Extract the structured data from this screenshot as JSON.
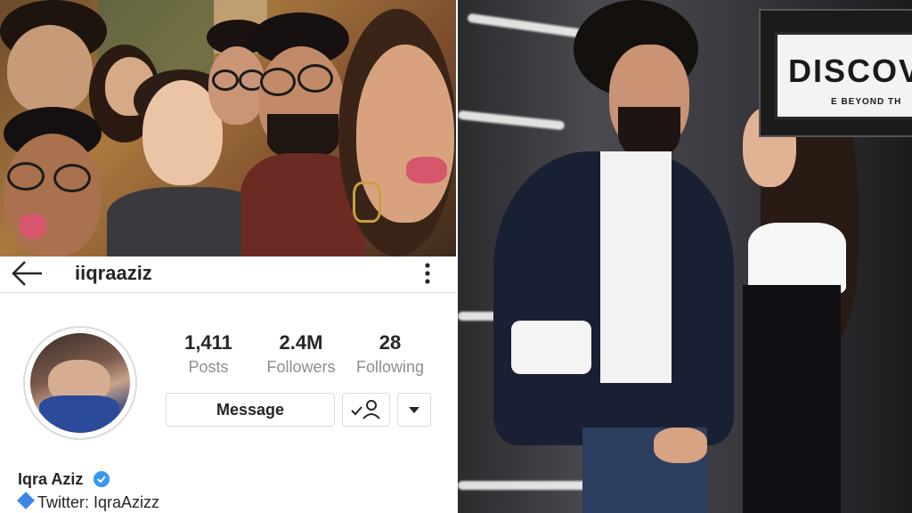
{
  "profile": {
    "username": "iiqraaziz",
    "stats": [
      {
        "value": "1,411",
        "label": "Posts"
      },
      {
        "value": "2.4M",
        "label": "Followers"
      },
      {
        "value": "28",
        "label": "Following"
      }
    ],
    "message_label": "Message",
    "full_name": "Iqra Aziz",
    "bio": "Twitter: IqraAzizz"
  },
  "right_photo": {
    "sign_text": "DISCOV",
    "sign_subtext": "E BEYOND TH"
  },
  "colors": {
    "verified": "#3897f0",
    "bio_bullet": "#3b86e8",
    "text_primary": "#262626",
    "text_secondary": "#8e8e8e",
    "border": "#dbdbdb"
  },
  "icons": {
    "back": "left-arrow-icon",
    "more": "vertical-dots-icon",
    "follow": "person-check-icon",
    "dropdown": "triangle-down-icon",
    "verified": "verified-badge-icon",
    "bio_bullet": "blue-diamond-icon"
  }
}
